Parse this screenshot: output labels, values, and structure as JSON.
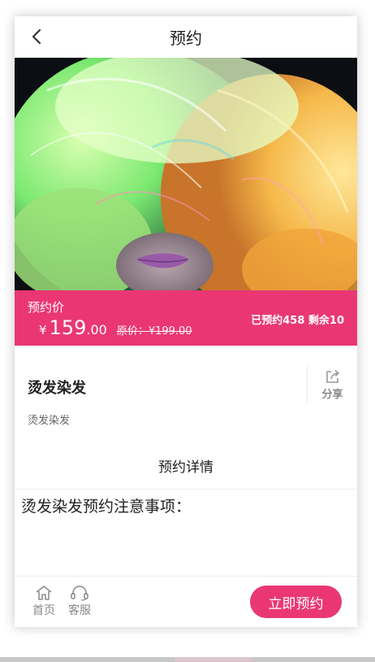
{
  "header": {
    "title": "预约",
    "back_icon": "chevron-left-icon"
  },
  "hero": {
    "image": "rainbow-colored-hair-photo"
  },
  "price": {
    "label": "预约价",
    "currency": "¥",
    "integer": "159",
    "decimal": ".00",
    "original": "原价：¥199.00",
    "sold_info": "已预约458 剩余10",
    "accent_color": "#ea3774"
  },
  "product": {
    "name": "烫发染发",
    "description": "烫发染发",
    "share_label": "分享",
    "share_icon": "share-icon"
  },
  "detail": {
    "heading": "预约详情",
    "notice": "烫发染发预约注意事项："
  },
  "footer": {
    "home_label": "首页",
    "home_icon": "home-icon",
    "service_label": "客服",
    "service_icon": "headset-icon",
    "book_button": "立即预约"
  }
}
